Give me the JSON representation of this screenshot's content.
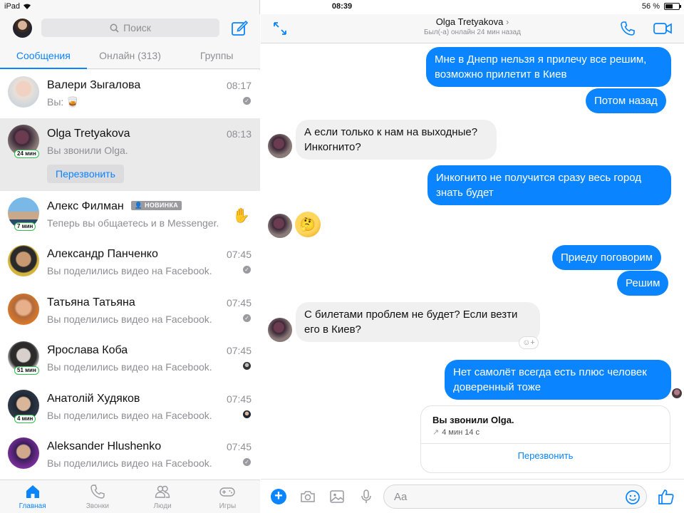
{
  "statusbar": {
    "device": "iPad",
    "time": "08:39",
    "battery": "56 %",
    "battery_level": 0.56
  },
  "left": {
    "search_placeholder": "Поиск",
    "tabs": [
      {
        "label": "Сообщения"
      },
      {
        "label": "Онлайн (313)"
      },
      {
        "label": "Группы"
      }
    ],
    "conversations": [
      {
        "name": "Валери Зыгалова",
        "time": "08:17",
        "preview": "Вы: 🥃"
      },
      {
        "name": "Olga Tretyakova",
        "time": "08:13",
        "preview": "Вы звонили Olga.",
        "active_badge": "24 мин",
        "action": "Перезвонить"
      },
      {
        "name": "Алекс Филман",
        "time": "",
        "preview": "Теперь вы общаетесь и в Messenger.",
        "active_badge": "7 мин",
        "tag": "НОВИНКА"
      },
      {
        "name": "Александр Панченко",
        "time": "07:45",
        "preview": "Вы поделились видео на Facebook."
      },
      {
        "name": "Татьяна Татьяна",
        "time": "07:45",
        "preview": "Вы поделились видео на Facebook."
      },
      {
        "name": "Ярослава Коба",
        "time": "07:45",
        "preview": "Вы поделились видео на Facebook.",
        "active_badge": "51 мин"
      },
      {
        "name": "Анатолій Худяков",
        "time": "07:45",
        "preview": "Вы поделились видео на Facebook.",
        "active_badge": "4 мин"
      },
      {
        "name": "Aleksander Hlushenko",
        "time": "07:45",
        "preview": "Вы поделились видео на Facebook."
      }
    ],
    "tabbar": [
      {
        "label": "Главная"
      },
      {
        "label": "Звонки"
      },
      {
        "label": "Люди"
      },
      {
        "label": "Игры"
      }
    ]
  },
  "chat": {
    "title": "Olga Tretyakova",
    "subtitle": "Был(-а) онлайн 24 мин назад",
    "messages": [
      {
        "dir": "out",
        "text": "Мне в Днепр нельзя я прилечу все решим, возможно прилетит в Киев"
      },
      {
        "dir": "out",
        "text": "Потом назад"
      },
      {
        "dir": "in",
        "text": "А если только к нам на выходные? Инкогнито?"
      },
      {
        "dir": "out",
        "text": "Инкогнито не получится сразу весь город знать будет"
      },
      {
        "dir": "in",
        "text": "🤔"
      },
      {
        "dir": "out",
        "text": "Приеду поговорим"
      },
      {
        "dir": "out",
        "text": "Решим"
      },
      {
        "dir": "in",
        "text": "С билетами проблем не будет? Если везти его в Киев?"
      },
      {
        "dir": "out",
        "text": "Нет самолёт всегда есть плюс человек доверенный тоже"
      }
    ],
    "call_card": {
      "title": "Вы звонили Olga.",
      "duration": "4 мин 14 с",
      "action": "Перезвонить"
    },
    "composer_placeholder": "Aa"
  },
  "colors": {
    "accent": "#0a84ff",
    "online": "#2fbf4d"
  }
}
